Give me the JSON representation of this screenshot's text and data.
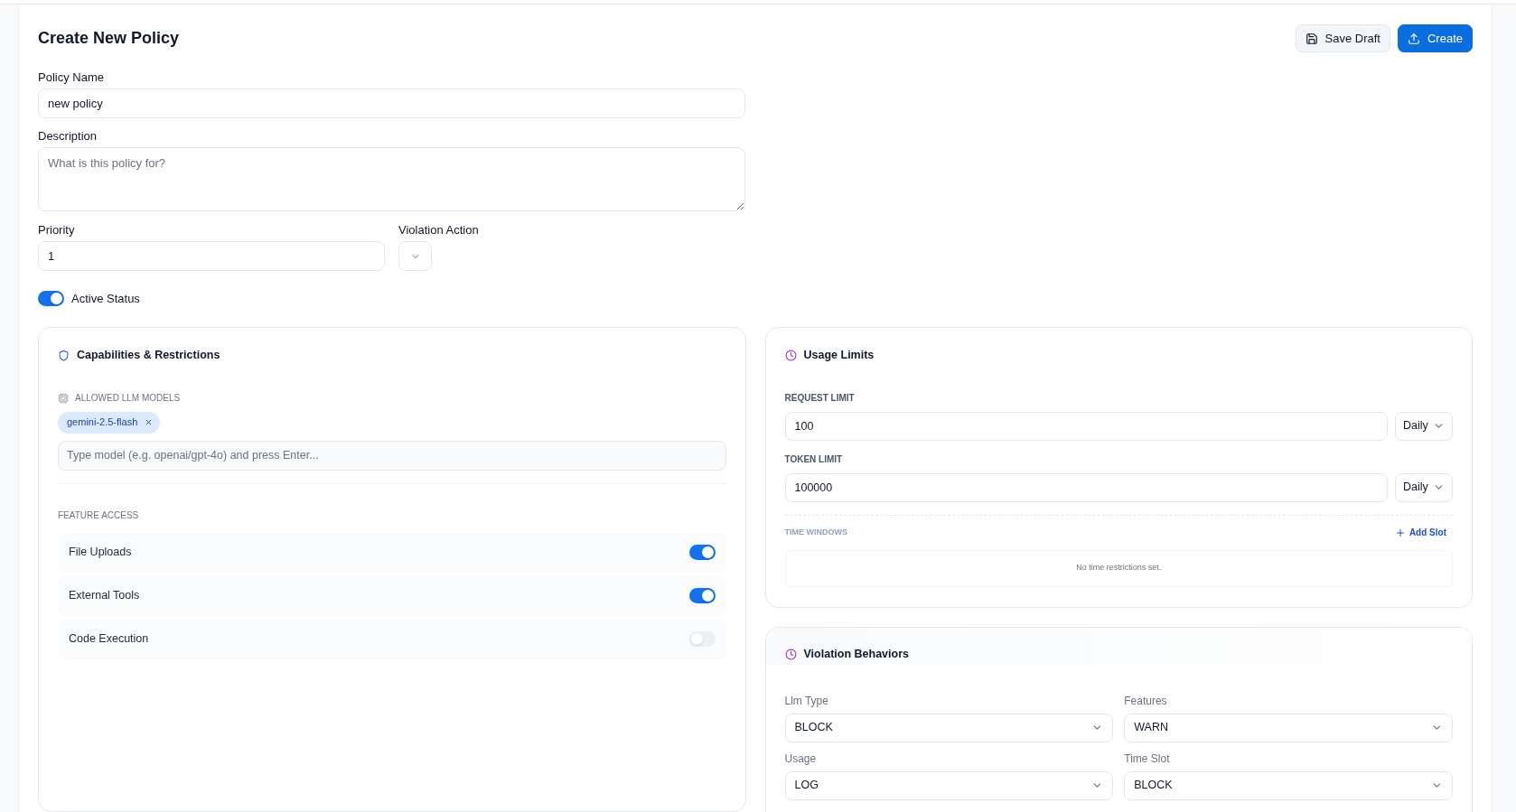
{
  "header": {
    "title": "Create New Policy",
    "actions": [
      {
        "label": "Save Draft",
        "kind": "secondary"
      },
      {
        "label": "Create",
        "kind": "primary"
      }
    ]
  },
  "form": {
    "policy_name": {
      "label": "Policy Name",
      "value": "new policy"
    },
    "description": {
      "label": "Description",
      "placeholder": "What is this policy for?"
    },
    "priority": {
      "label": "Priority",
      "value": "1"
    },
    "violation_action": {
      "label": "Violation Action"
    },
    "active_status": {
      "label": "Active Status",
      "on": true
    }
  },
  "capabilities": {
    "title": "Capabilities & Restrictions",
    "allowed_models": {
      "label": "ALLOWED LLM MODELS",
      "chips": [
        {
          "label": "gemini-2.5-flash"
        }
      ],
      "placeholder": "Type model (e.g. openai/gpt-4o) and press Enter..."
    },
    "feature_access": {
      "label": "FEATURE ACCESS",
      "items": [
        {
          "label": "File Uploads",
          "on": true
        },
        {
          "label": "External Tools",
          "on": true
        },
        {
          "label": "Code Execution",
          "on": false
        }
      ]
    }
  },
  "usage_limits": {
    "title": "Usage Limits",
    "limits": [
      {
        "label": "REQUEST LIMIT",
        "value": "100",
        "period": "Daily"
      },
      {
        "label": "TOKEN LIMIT",
        "value": "100000",
        "period": "Daily"
      }
    ],
    "time_windows": {
      "label": "TIME WINDOWS",
      "add_label": "Add Slot",
      "empty_text": "No time restrictions set."
    }
  },
  "violation_behaviors": {
    "title": "Violation Behaviors",
    "fields": [
      {
        "label": "Llm Type",
        "value": "BLOCK"
      },
      {
        "label": "Features",
        "value": "WARN"
      },
      {
        "label": "Usage",
        "value": "LOG"
      },
      {
        "label": "Time Slot",
        "value": "BLOCK"
      }
    ]
  }
}
